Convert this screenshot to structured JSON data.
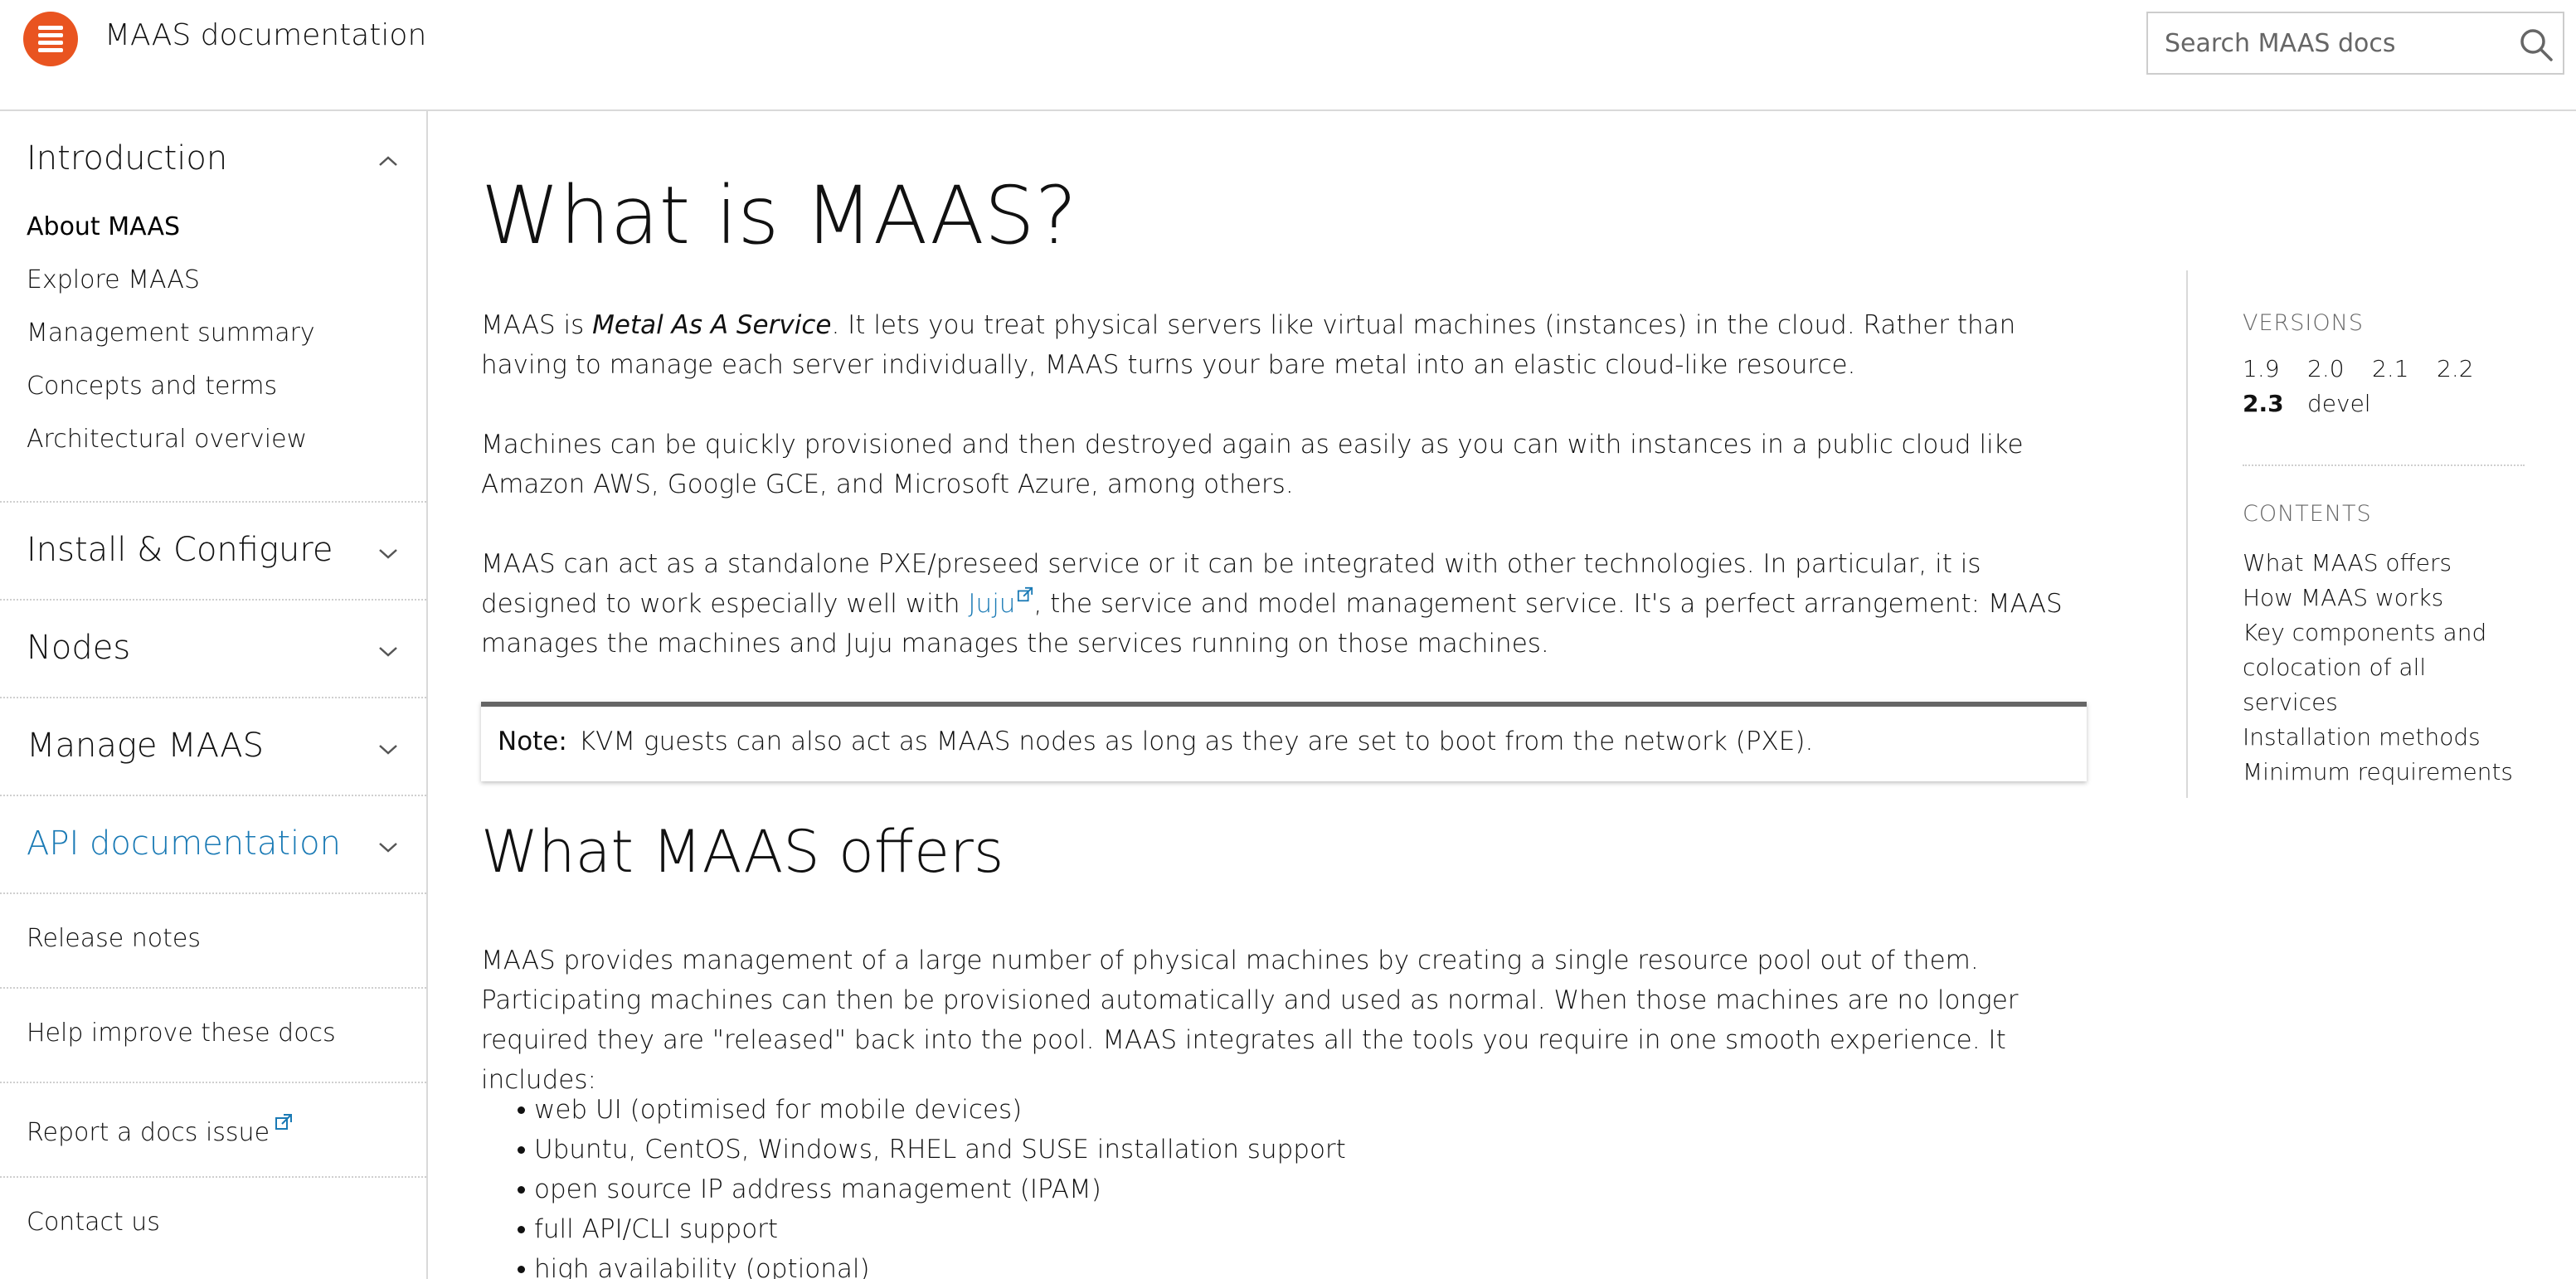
{
  "header": {
    "site_title": "MAAS documentation",
    "search_placeholder": "Search MAAS docs",
    "brand_color": "#e95420"
  },
  "sidebar": {
    "sections": [
      {
        "label": "Introduction",
        "expanded": true,
        "items": [
          "About MAAS",
          "Explore MAAS",
          "Management summary",
          "Concepts and terms",
          "Architectural overview"
        ],
        "active_item": "About MAAS"
      },
      {
        "label": "Install & Configure",
        "expanded": false
      },
      {
        "label": "Nodes",
        "expanded": false
      },
      {
        "label": "Manage MAAS",
        "expanded": false
      },
      {
        "label": "API documentation",
        "expanded": false,
        "highlighted": true
      }
    ],
    "links": [
      "Release notes",
      "Help improve these docs",
      "Report a docs issue",
      "Contact us"
    ],
    "link_color": "#1a7ab5"
  },
  "main": {
    "title": "What is MAAS?",
    "p1_prefix": "MAAS is ",
    "p1_em": "Metal As A Service",
    "p1_suffix": ". It lets you treat physical servers like virtual machines (instances) in the cloud. Rather than having to manage each server individually, MAAS turns your bare metal into an elastic cloud-like resource.",
    "p2": "Machines can be quickly provisioned and then destroyed again as easily as you can with instances in a public cloud like Amazon AWS, Google GCE, and Microsoft Azure, among others.",
    "p3_prefix": "MAAS can act as a standalone PXE/preseed service or it can be integrated with other technologies. In particular, it is designed to work especially well with ",
    "p3_link": "Juju",
    "p3_suffix": ", the service and model management service. It's a perfect arrangement: MAAS manages the machines and Juju manages the services running on those machines.",
    "note_label": "Note:",
    "note_text": "KVM guests can also act as MAAS nodes as long as they are set to boot from the network (PXE).",
    "h2": "What MAAS offers",
    "p4": "MAAS provides management of a large number of physical machines by creating a single resource pool out of them. Participating machines can then be provisioned automatically and used as normal. When those machines are no longer required they are \"released\" back into the pool. MAAS integrates all the tools you require in one smooth experience. It includes:",
    "features": [
      "web UI (optimised for mobile devices)",
      "Ubuntu, CentOS, Windows, RHEL and SUSE installation support",
      "open source IP address management (IPAM)",
      "full API/CLI support",
      "high availability (optional)"
    ]
  },
  "aside": {
    "versions_label": "VERSIONS",
    "versions": [
      "1.9",
      "2.0",
      "2.1",
      "2.2",
      "2.3",
      "devel"
    ],
    "current_version": "2.3",
    "contents_label": "CONTENTS",
    "contents": [
      "What MAAS offers",
      "How MAAS works",
      "Key components and colocation of all services",
      "Installation methods",
      "Minimum requirements"
    ]
  }
}
